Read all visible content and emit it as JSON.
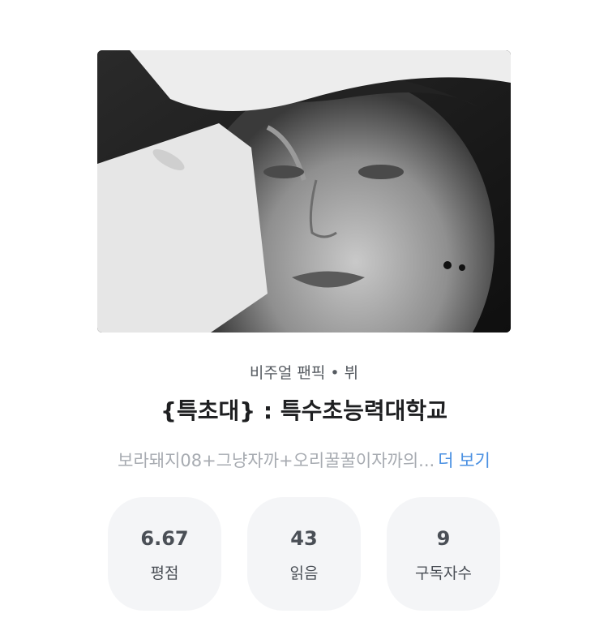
{
  "work": {
    "category": "비주얼 팬픽",
    "separator": "•",
    "character": "뷔",
    "title": "{특초대} : 특수초능력대학교",
    "description": "보라돼지08+그냥자까+오리꿀꿀이자까의...",
    "more_label": "더 보기"
  },
  "stats": {
    "rating": {
      "value": "6.67",
      "label": "평점"
    },
    "reads": {
      "value": "43",
      "label": "읽음"
    },
    "subscribers": {
      "value": "9",
      "label": "구독자수"
    }
  },
  "colors": {
    "accent": "#4a90e2",
    "stat_background": "#f4f5f7",
    "muted_text": "#a7abb1"
  }
}
